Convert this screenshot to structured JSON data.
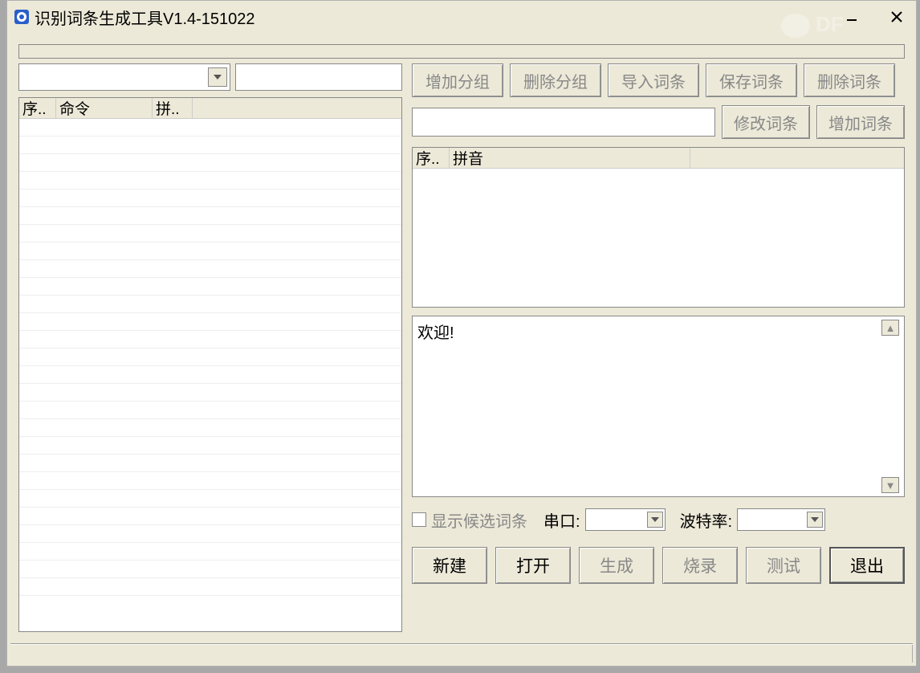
{
  "window": {
    "title": "识别词条生成工具V1.4-151022"
  },
  "watermark": {
    "text": "DF"
  },
  "left_table": {
    "col1": "序..",
    "col2": "命令",
    "col3": "拼.."
  },
  "buttons": {
    "add_group": "增加分组",
    "del_group": "删除分组",
    "import_entry": "导入词条",
    "save_entry": "保存词条",
    "delete_entry": "删除词条",
    "modify_entry": "修改词条",
    "add_entry": "增加词条"
  },
  "pinyin_table": {
    "col1": "序..",
    "col2": "拼音"
  },
  "log": {
    "welcome": "欢迎!"
  },
  "options": {
    "show_candidates": "显示候选词条",
    "serial_port": "串口:",
    "baud_rate": "波特率:"
  },
  "bottom": {
    "new": "新建",
    "open": "打开",
    "generate": "生成",
    "flash": "烧录",
    "test": "测试",
    "exit": "退出"
  }
}
